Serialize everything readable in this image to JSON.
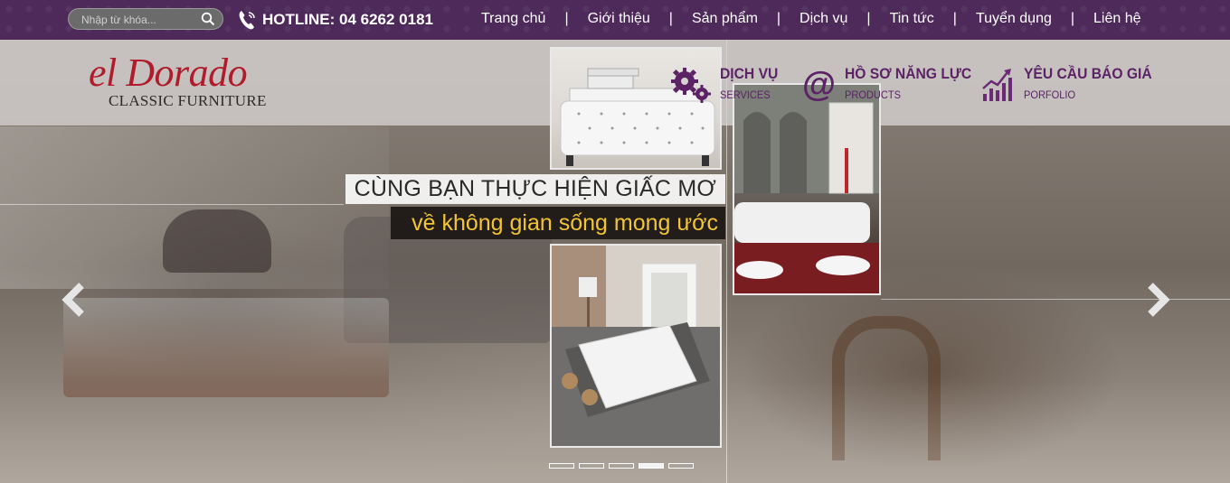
{
  "topbar": {
    "search_placeholder": "Nhập từ khóa...",
    "hotline": "HOTLINE: 04 6262 0181",
    "nav": [
      "Trang chủ",
      "Giới thiệu",
      "Sản phẩm",
      "Dịch vụ",
      "Tin tức",
      "Tuyển dụng",
      "Liên hệ"
    ],
    "separator": "|",
    "bg_color": "#4e2a5a"
  },
  "logo": {
    "main": "el Dorado",
    "sub": "CLASSIC FURNITURE",
    "main_color": "#b01c2b"
  },
  "services": [
    {
      "title": "DỊCH VỤ",
      "subtitle": "SERVICES",
      "icon": "gears-icon"
    },
    {
      "title": "HỒ SƠ NĂNG LỰC",
      "subtitle": "PRODUCTS",
      "icon": "at-icon"
    },
    {
      "title": "YÊU CẦU BÁO GIÁ",
      "subtitle": "PORFOLIO",
      "icon": "chart-icon"
    }
  ],
  "slider": {
    "tagline_1": "CÙNG BẠN THỰC HIỆN GIẤC MƠ",
    "tagline_2": "về không gian sống mong ước",
    "tagline_2_color": "#f2c534",
    "dots_count": 5,
    "active_dot_index": 3,
    "accent_color": "#5b2266"
  }
}
